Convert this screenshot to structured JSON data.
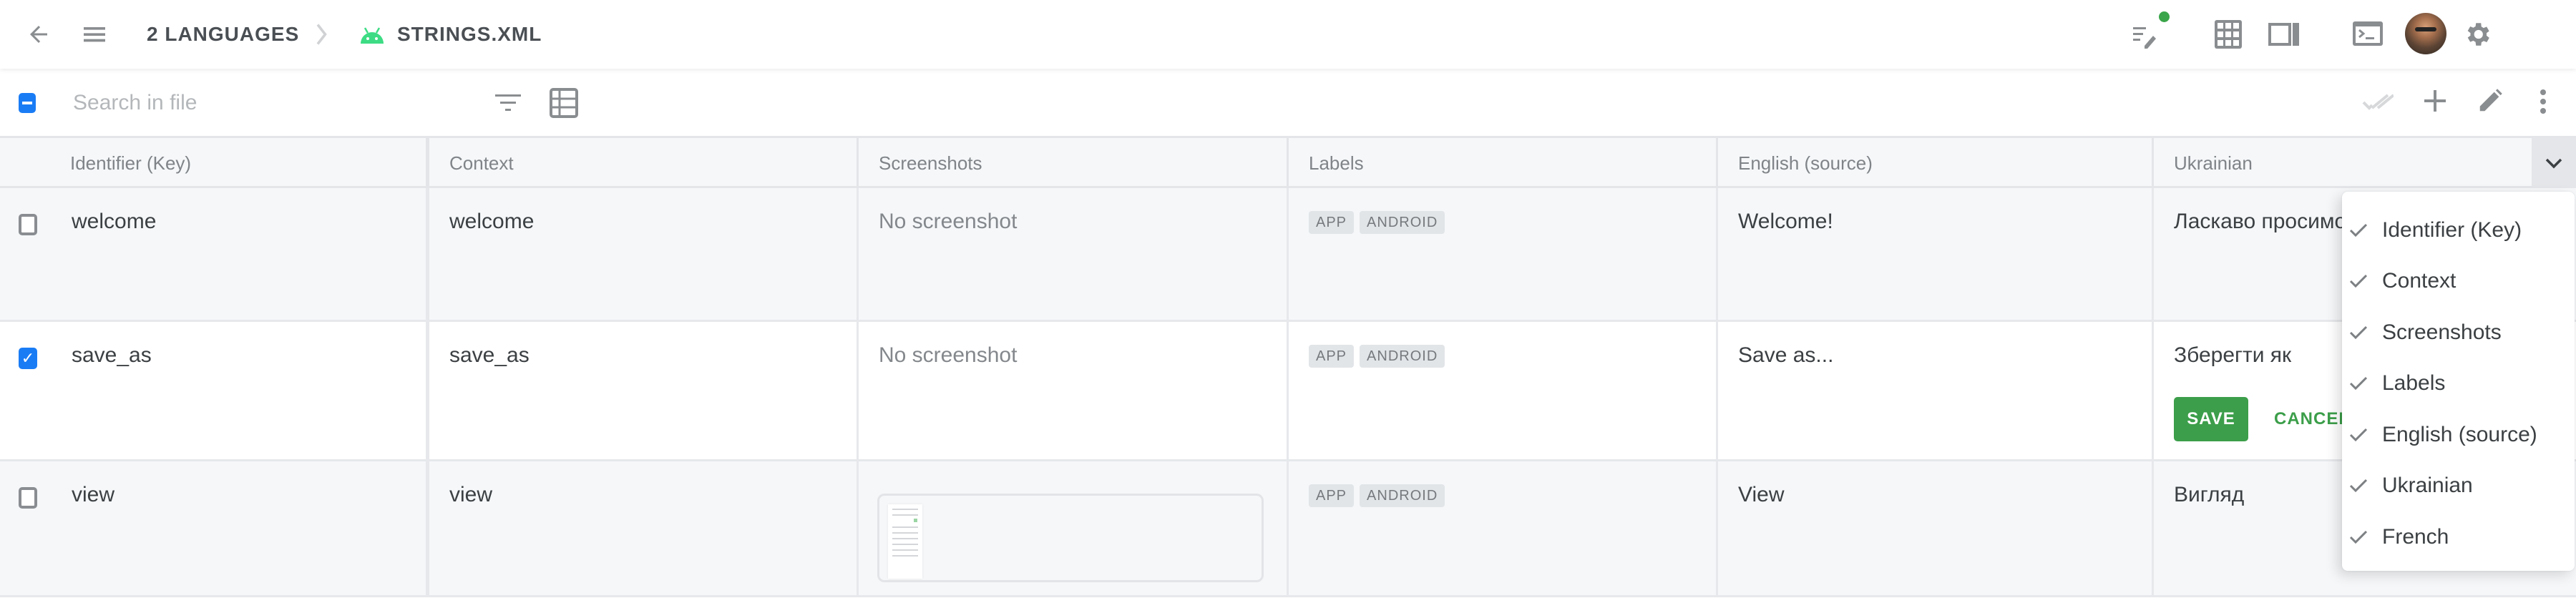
{
  "appbar": {
    "breadcrumb": [
      {
        "label": "2 LANGUAGES"
      },
      {
        "label": "STRINGS.XML",
        "icon": "android-icon"
      }
    ],
    "colors": {
      "android": "#3ddc84",
      "status_dot": "#3aa54a"
    },
    "right_icons": [
      "review-edit-icon",
      "grid-icon",
      "side-panel-icon",
      "terminal-icon",
      "keyboard-icon",
      "settings-gear-icon",
      "avatar"
    ]
  },
  "toolbar": {
    "search_placeholder": "Search in file",
    "search_value": "",
    "left_icons": [
      "filter-icon",
      "table-layout-icon"
    ],
    "right_icons": [
      "double-check-icon",
      "add-icon",
      "edit-pencil-icon",
      "more-vert-icon"
    ]
  },
  "table": {
    "columns": [
      "Identifier (Key)",
      "Context",
      "Screenshots",
      "Labels",
      "English (source)",
      "Ukrainian"
    ],
    "rows": [
      {
        "checked": false,
        "key": "welcome",
        "context": "welcome",
        "screenshot": "No screenshot",
        "labels": [
          "APP",
          "ANDROID"
        ],
        "english": "Welcome!",
        "ukrainian": "Ласкаво просимо!"
      },
      {
        "checked": true,
        "key": "save_as",
        "context": "save_as",
        "screenshot": "No screenshot",
        "labels": [
          "APP",
          "ANDROID"
        ],
        "english": "Save as...",
        "ukrainian": "Зберегти як",
        "editing": true,
        "save_label": "SAVE",
        "cancel_label": "CANCEL"
      },
      {
        "checked": false,
        "key": "view",
        "context": "view",
        "screenshot": "",
        "has_thumbnail": true,
        "labels": [
          "APP",
          "ANDROID"
        ],
        "english": "View",
        "ukrainian": "Вигляд"
      }
    ]
  },
  "column_menu": {
    "items": [
      {
        "label": "Identifier (Key)",
        "checked": true
      },
      {
        "label": "Context",
        "checked": true
      },
      {
        "label": "Screenshots",
        "checked": true
      },
      {
        "label": "Labels",
        "checked": true
      },
      {
        "label": "English (source)",
        "checked": true
      },
      {
        "label": "Ukrainian",
        "checked": true
      },
      {
        "label": "French",
        "checked": true
      }
    ]
  },
  "colors": {
    "accent_blue": "#1a7cf5",
    "save_green": "#3c9e4a"
  }
}
